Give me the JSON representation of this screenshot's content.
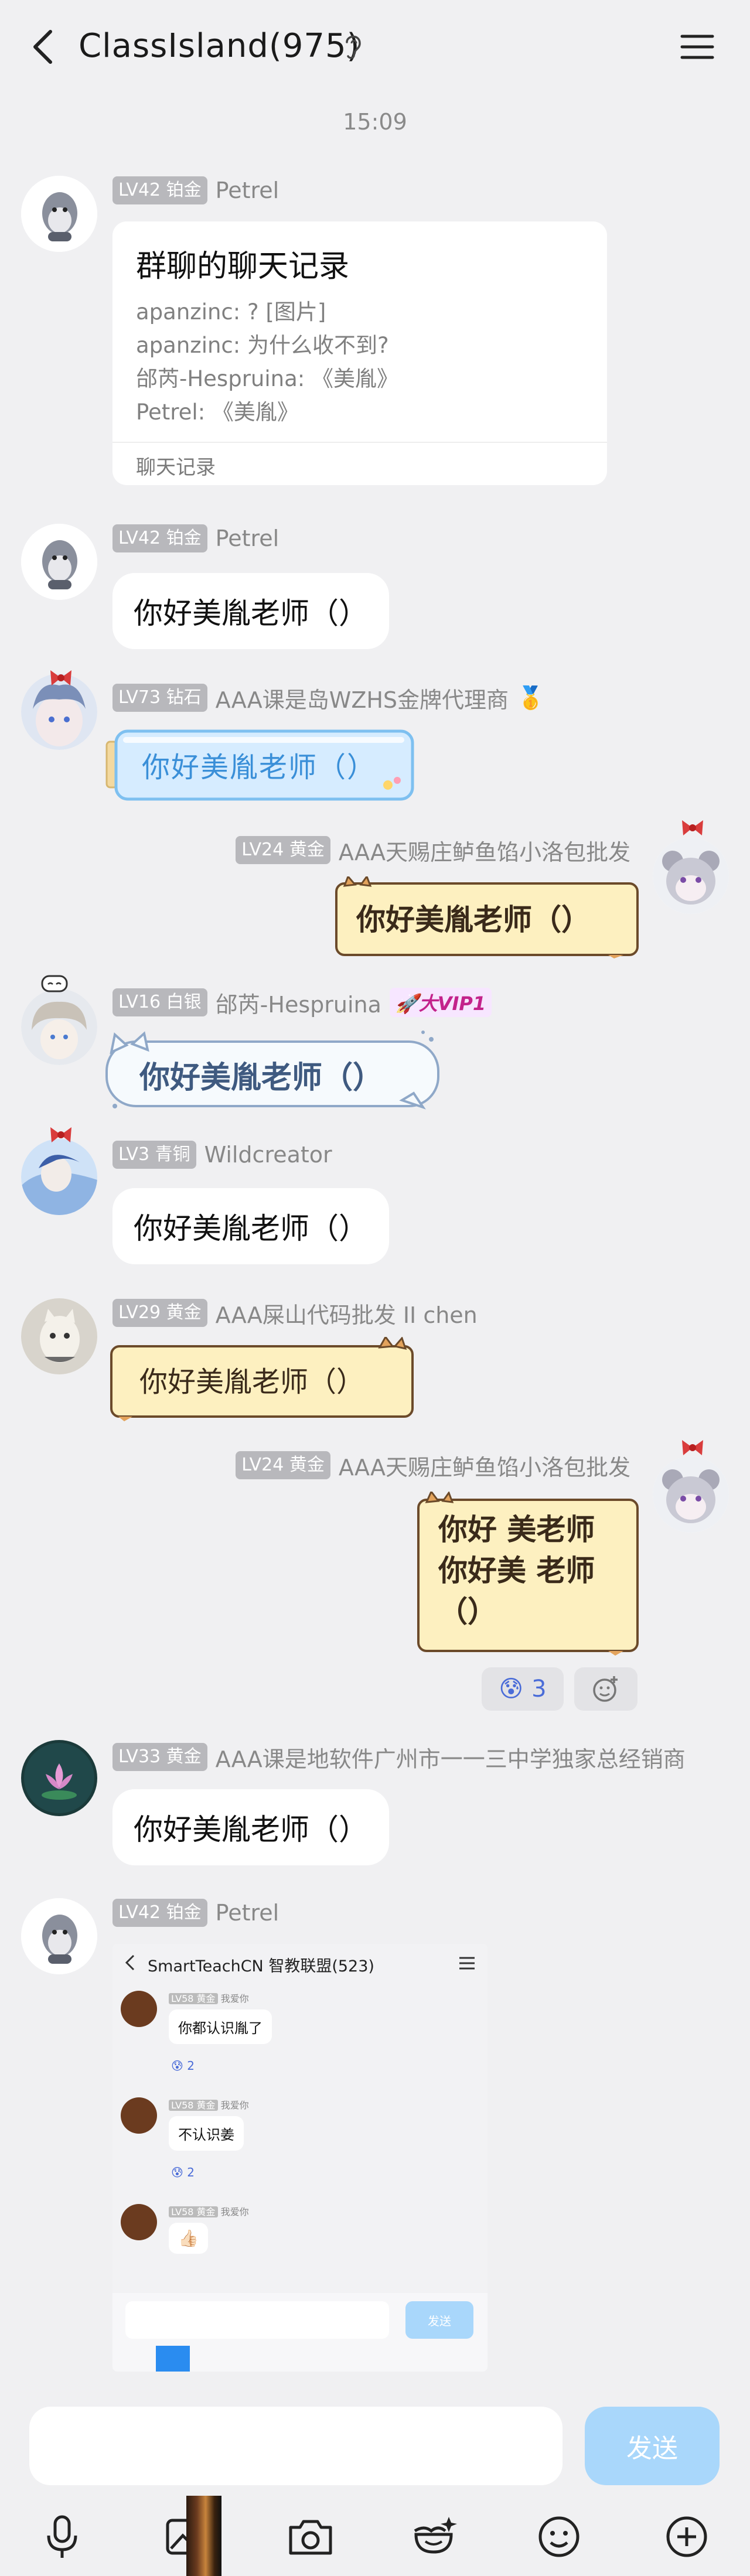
{
  "header": {
    "title": "ClassIsland(975)"
  },
  "time": "15:09",
  "messages": [
    {
      "level": "LV42 铂金",
      "name": "Petrel",
      "card": {
        "title": "群聊的聊天记录",
        "lines": [
          "apanzinc: ? [图片]",
          "apanzinc: 为什么收不到?",
          "邰芮-Hespruina: 《美胤》",
          "Petrel: 《美胤》"
        ],
        "footer": "聊天记录"
      }
    },
    {
      "level": "LV42 铂金",
      "name": "Petrel",
      "text": "你好美胤老师（）"
    },
    {
      "level": "LV73 钻石",
      "name": "AAA课是岛WZHS金牌代理商",
      "medal": "🥇",
      "text": "你好美胤老师（）"
    },
    {
      "level": "LV24 黄金",
      "name": "AAA天赐庄鲈鱼馅小洛包批发",
      "text": "你好美胤老师（）"
    },
    {
      "level": "LV16 白银",
      "name": "邰芮-Hespruina",
      "vip": "大VIP1",
      "text": "你好美胤老师（）"
    },
    {
      "level": "LV3 青铜",
      "name": "Wildcreator",
      "text": "你好美胤老师（）"
    },
    {
      "level": "LV29 黄金",
      "name": "AAA屎山代码批发 II chen",
      "text": "你好美胤老师（）"
    },
    {
      "level": "LV24 黄金",
      "name": "AAA天赐庄鲈鱼馅小洛包批发",
      "lines": [
        "你好 美老师",
        "你好美 老师",
        "（）"
      ],
      "reaction": {
        "emoji": "😰",
        "count": "3"
      }
    },
    {
      "level": "LV33 黄金",
      "name": "AAA课是地软件广州市一一三中学独家总经销商",
      "text": "你好美胤老师（）"
    },
    {
      "level": "LV42 铂金",
      "name": "Petrel",
      "screenshot": {
        "title": "SmartTeachCN 智教联盟(523)",
        "items": [
          {
            "level": "LV58 黄金",
            "name": "我爱你",
            "text": "你都认识胤了",
            "reaction": "😰 2"
          },
          {
            "level": "LV58 黄金",
            "name": "我爱你",
            "text": "不认识姜",
            "reaction": "😰 2"
          },
          {
            "level": "LV58 黄金",
            "name": "我爱你",
            "text": "👍🏻"
          }
        ],
        "send": "发送"
      }
    }
  ],
  "input": {
    "placeholder": "",
    "send": "发送"
  },
  "toolbar": [
    "mic-icon",
    "image-icon",
    "camera-icon",
    "sticker-icon",
    "emoji-icon",
    "plus-icon"
  ],
  "colors": {
    "background": "#f0f0f2",
    "send_button": "#a9d7fb",
    "badge": "#b8b8bc",
    "fancy_yellow": "#fdf0c0",
    "fancy_blue": "#d6ecff"
  }
}
